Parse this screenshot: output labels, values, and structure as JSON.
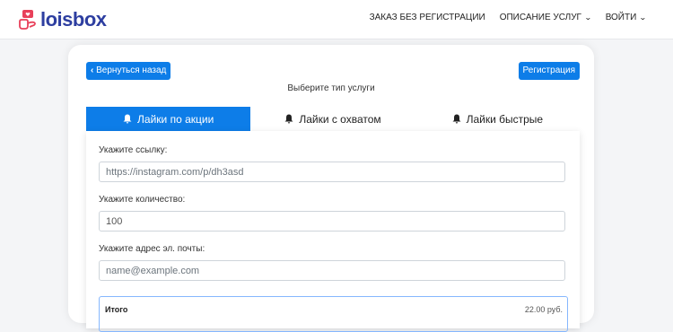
{
  "brand": {
    "name": "loisbox"
  },
  "nav": {
    "items": [
      {
        "label": "ЗАКАЗ БЕЗ РЕГИСТРАЦИИ",
        "dropdown": false
      },
      {
        "label": "ОПИСАНИЕ УСЛУГ",
        "dropdown": true
      },
      {
        "label": "ВОЙТИ",
        "dropdown": true
      }
    ]
  },
  "card": {
    "back_label": "Вернуться назад",
    "register_label": "Регистрация",
    "title": "Выберите тип услуги"
  },
  "tabs": [
    {
      "label": "Лайки по акции",
      "icon": "bell-icon",
      "active": true
    },
    {
      "label": "Лайки с охватом",
      "icon": "bell-icon",
      "active": false
    },
    {
      "label": "Лайки быстрые",
      "icon": "bell-icon",
      "active": false
    }
  ],
  "form": {
    "link": {
      "label": "Укажите ссылку:",
      "placeholder": "https://instagram.com/p/dh3asd",
      "value": ""
    },
    "quantity": {
      "label": "Укажите количество:",
      "placeholder": "",
      "value": "100"
    },
    "email": {
      "label": "Укажите адрес эл. почты:",
      "placeholder": "name@example.com",
      "value": ""
    },
    "total": {
      "label": "Итого",
      "value": "22.00 руб."
    }
  },
  "colors": {
    "accent": "#0d7de8",
    "brand": "#2d3ea0",
    "logo_mark": "#e8405a"
  }
}
